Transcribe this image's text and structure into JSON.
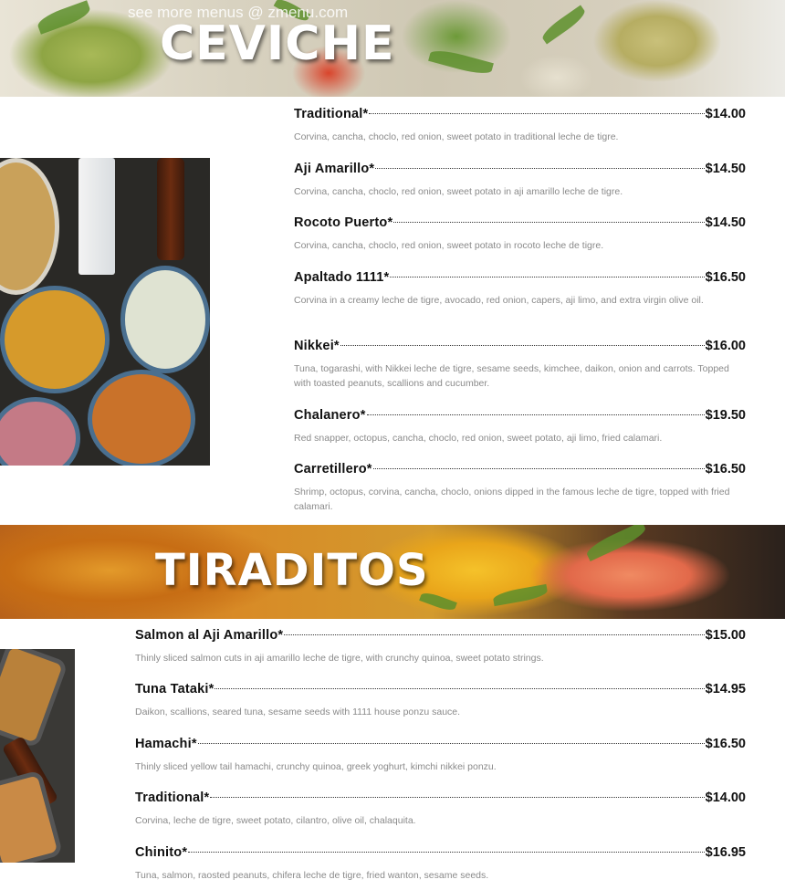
{
  "watermark": "see more menus @ zmenu.com",
  "ceviche": {
    "title": "CEVICHE",
    "items": [
      {
        "name": "Traditional*",
        "price": "$14.00",
        "desc": "Corvina, cancha, choclo, red onion, sweet potato in traditional leche de tigre."
      },
      {
        "name": "Aji Amarillo*",
        "price": "$14.50",
        "desc": "Corvina, cancha, choclo, red onion, sweet potato in aji amarillo leche de tigre."
      },
      {
        "name": "Rocoto Puerto*",
        "price": "$14.50",
        "desc": "Corvina, cancha, choclo, red onion, sweet potato in rocoto leche de tigre."
      },
      {
        "name": "Apaltado 1111*",
        "price": "$16.50",
        "desc": "Corvina in a creamy leche de tigre, avocado, red onion, capers, aji limo, and extra virgin olive oil."
      },
      {
        "name": "Nikkei*",
        "price": "$16.00",
        "desc": "Tuna, togarashi, with Nikkei leche de tigre, sesame seeds, kimchee, daikon, onion and carrots. Topped with toasted peanuts, scallions and cucumber."
      },
      {
        "name": "Chalanero*",
        "price": "$19.50",
        "desc": "Red snapper, octopus, cancha, choclo, red onion, sweet potato, aji limo, fried calamari."
      },
      {
        "name": "Carretillero*",
        "price": "$16.50",
        "desc": "Shrimp, octopus, corvina, cancha, choclo, onions dipped in the famous leche de tigre, topped with fried calamari."
      }
    ]
  },
  "tiraditos": {
    "title": "TIRADITOS",
    "items": [
      {
        "name": "Salmon al Aji Amarillo*",
        "price": "$15.00",
        "desc": "Thinly sliced salmon cuts in aji amarillo leche de tigre, with crunchy quinoa, sweet potato strings."
      },
      {
        "name": "Tuna Tataki*",
        "price": "$14.95",
        "desc": "Daikon, scallions, seared tuna, sesame seeds with 1111 house ponzu sauce."
      },
      {
        "name": "Hamachi*",
        "price": "$16.50",
        "desc": "Thinly sliced yellow tail hamachi, crunchy quinoa, greek yoghurt, kimchi nikkei ponzu."
      },
      {
        "name": "Traditional*",
        "price": "$14.00",
        "desc": "Corvina, leche de tigre, sweet potato, cilantro, olive oil, chalaquita."
      },
      {
        "name": "Chinito*",
        "price": "$16.95",
        "desc": "Tuna, salmon, raosted peanuts, chifera leche de tigre, fried wanton, sesame seeds."
      }
    ]
  }
}
